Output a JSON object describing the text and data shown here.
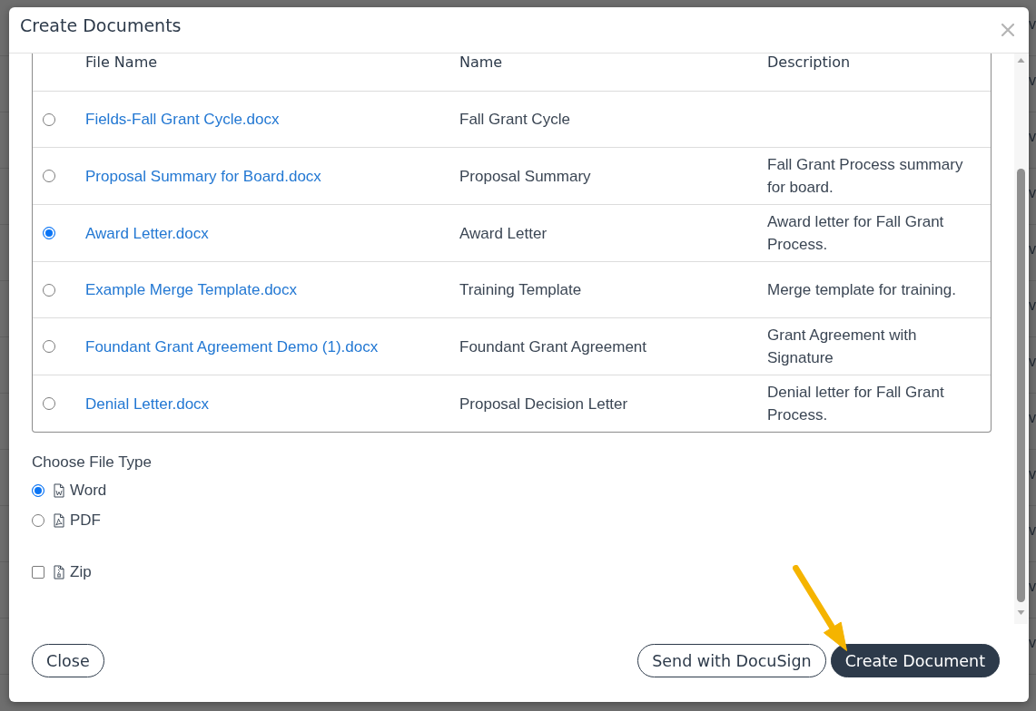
{
  "window": {
    "title": "Create Documents"
  },
  "table": {
    "columns": [
      "File Name",
      "Name",
      "Description"
    ],
    "rows": [
      {
        "file_name": "Fields-Fall Grant Cycle.docx",
        "name": "Fall Grant Cycle",
        "selected": false
      },
      {
        "file_name": "Proposal Summary for Board.docx",
        "name": "Proposal Summary",
        "description": "Fall Grant Process summary for board.",
        "selected": false
      },
      {
        "file_name": "Award Letter.docx",
        "name": "Award Letter",
        "description": "Award letter for Fall Grant Process.",
        "selected": true
      },
      {
        "file_name": "Example Merge Template.docx",
        "name": "Training Template",
        "description": "Merge template for training.",
        "selected": false
      },
      {
        "file_name": "Foundant Grant Agreement Demo (1).docx",
        "name": "Foundant Grant Agreement",
        "description": "Grant Agreement with Signature",
        "selected": false
      },
      {
        "file_name": "Denial Letter.docx",
        "name": "Proposal Decision Letter",
        "description": "Denial letter for Fall Grant Process.",
        "selected": false
      }
    ]
  },
  "file_type": {
    "label": "Choose File Type",
    "options": [
      {
        "label": "Word",
        "kind": "word",
        "selected": true
      },
      {
        "label": "PDF",
        "kind": "pdf",
        "selected": false
      }
    ],
    "zip": {
      "label": "Zip",
      "checked": false
    }
  },
  "footer": {
    "left": [
      {
        "label": "Close",
        "kind": "outline"
      }
    ],
    "right": [
      {
        "label": "Send with DocuSign",
        "kind": "outline"
      },
      {
        "label": "Create Document",
        "kind": "primary"
      }
    ]
  },
  "background": {
    "row_texts": [
      "v",
      "v",
      "v",
      "v",
      "v",
      "v",
      "v",
      "v",
      "v",
      "v",
      "v",
      "v"
    ]
  }
}
